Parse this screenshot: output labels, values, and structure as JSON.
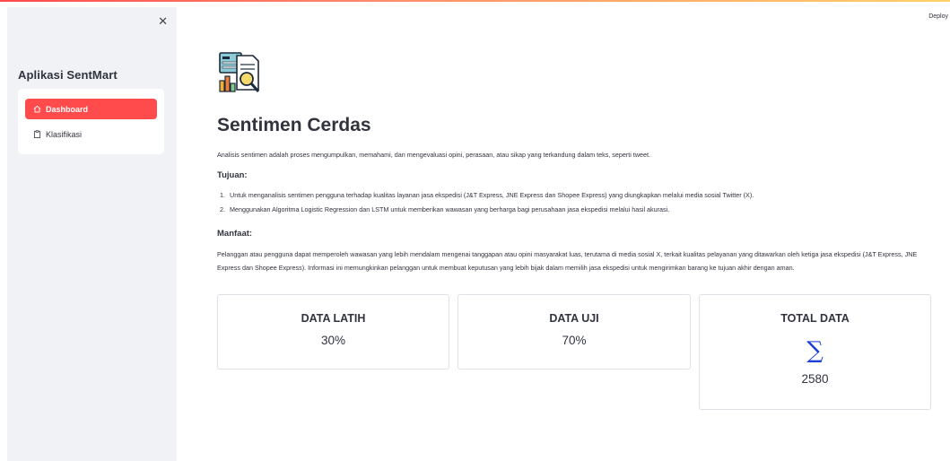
{
  "sidebar": {
    "title": "Aplikasi SentMart",
    "close_icon": "close-icon",
    "items": [
      {
        "label": "Dashboard",
        "icon": "home-icon",
        "active": true
      },
      {
        "label": "Klasifikasi",
        "icon": "clipboard-icon",
        "active": false
      }
    ]
  },
  "header": {
    "deploy_label": "Deploy"
  },
  "main": {
    "title": "Sentimen Cerdas",
    "intro": "Analisis sentimen adalah proses mengumpulkan, memahami, dan mengevaluasi opini, perasaan, atau sikap yang terkandung dalam teks, seperti tweet.",
    "tujuan_heading": "Tujuan:",
    "tujuan_items": [
      {
        "num": "1.",
        "text": "Untuk menganalisis sentimen pengguna terhadap kualitas layanan jasa ekspedisi (J&T Express, JNE Express dan Shopee Express) yang diungkapkan melalui media sosial Twitter (X)."
      },
      {
        "num": "2.",
        "text": "Menggunakan Algoritma Logistic Regression dan LSTM untuk memberikan wawasan yang berharga bagi perusahaan jasa ekspedisi melalui hasil akurasi."
      }
    ],
    "manfaat_heading": "Manfaat:",
    "manfaat_text": "Pelanggan atau pengguna dapat memperoleh wawasan yang lebih mendalam mengenai tanggapan atau opini masyarakat luas, terutama di media sosial X, terkait kualitas pelayanan yang ditawarkan oleh ketiga jasa ekspedisi (J&T Express, JNE Express dan Shopee Express). Informasi ini memungkinkan pelanggan untuk membuat keputusan yang lebih bijak dalam memilih jasa ekspedisi untuk mengirimkan barang ke tujuan akhir dengan aman.",
    "cards": [
      {
        "title": "DATA LATIH",
        "value": "30%"
      },
      {
        "title": "DATA UJI",
        "value": "70%"
      },
      {
        "title": "TOTAL DATA",
        "symbol": "∑",
        "value": "2580"
      }
    ]
  },
  "colors": {
    "accent": "#ff4b4b",
    "sidebar_bg": "#f0f2f6",
    "sigma": "#1f3fd6"
  }
}
